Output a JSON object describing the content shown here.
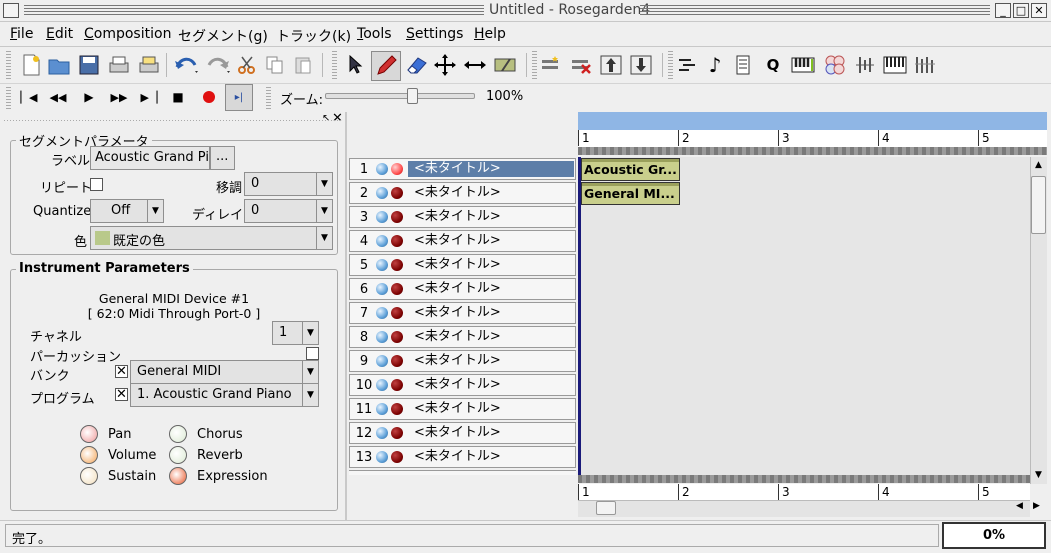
{
  "window": {
    "title": "Untitled - Rosegarden4",
    "minimize": "_",
    "maximize": "□",
    "close": "✕"
  },
  "menu": [
    {
      "label": "File",
      "u": "F",
      "rest": "ile"
    },
    {
      "label": "Edit",
      "u": "E",
      "rest": "dit"
    },
    {
      "label": "Composition",
      "u": "C",
      "rest": "omposition"
    },
    {
      "label": "セグメント(g)",
      "u": "",
      "rest": "セグメント(g)"
    },
    {
      "label": "トラック(k)",
      "u": "",
      "rest": "トラック(k)"
    },
    {
      "label": "Tools",
      "u": "T",
      "rest": "ools"
    },
    {
      "label": "Settings",
      "u": "S",
      "rest": "ettings"
    },
    {
      "label": "Help",
      "u": "H",
      "rest": "elp"
    }
  ],
  "transport": {
    "zoom_label": "ズーム:",
    "zoom_value": "100%",
    "zoom_level_fraction": 0.58
  },
  "segment_params": {
    "title": "セグメントパラメータ",
    "label_label": "ラベル",
    "label_value": "Acoustic Grand Piano",
    "label_button": "...",
    "repeat_label": "リピート",
    "transpose_label": "移調",
    "transpose_value": "0",
    "quantize_label": "Quantize",
    "quantize_value": "Off",
    "delay_label": "ディレイ",
    "delay_value": "0",
    "color_label": "色",
    "color_value": "既定の色",
    "color_swatch": "#b9c98a"
  },
  "instrument_params": {
    "title": "Instrument Parameters",
    "device": "General MIDI Device #1",
    "port": "[ 62:0 Midi Through Port-0 ]",
    "channel_label": "チャネル",
    "channel_value": "1",
    "percussion_label": "パーカッション",
    "bank_label": "バンク",
    "bank_value": "General MIDI",
    "program_label": "プログラム",
    "program_value": "1. Acoustic Grand Piano",
    "knobs": [
      {
        "label": "Pan",
        "color": "#f4b8b8"
      },
      {
        "label": "Chorus",
        "color": "#e6f0e0"
      },
      {
        "label": "Volume",
        "color": "#f7c08a"
      },
      {
        "label": "Reverb",
        "color": "#e6f0e0"
      },
      {
        "label": "Sustain",
        "color": "#f6e8d0"
      },
      {
        "label": "Expression",
        "color": "#f08a6a"
      }
    ]
  },
  "tracks": [
    {
      "num": "1",
      "name": "<未タイトル>",
      "selected": true
    },
    {
      "num": "2",
      "name": "<未タイトル>"
    },
    {
      "num": "3",
      "name": "<未タイトル>"
    },
    {
      "num": "4",
      "name": "<未タイトル>"
    },
    {
      "num": "5",
      "name": "<未タイトル>"
    },
    {
      "num": "6",
      "name": "<未タイトル>"
    },
    {
      "num": "7",
      "name": "<未タイトル>"
    },
    {
      "num": "8",
      "name": "<未タイトル>"
    },
    {
      "num": "9",
      "name": "<未タイトル>"
    },
    {
      "num": "10",
      "name": "<未タイトル>"
    },
    {
      "num": "11",
      "name": "<未タイトル>"
    },
    {
      "num": "12",
      "name": "<未タイトル>"
    },
    {
      "num": "13",
      "name": "<未タイトル>"
    }
  ],
  "ruler": {
    "bars": [
      "1",
      "2",
      "3",
      "4",
      "5"
    ]
  },
  "segments": [
    {
      "label": "Acoustic Gr..."
    },
    {
      "label": "General MI..."
    }
  ],
  "status": {
    "message": "完了。",
    "progress": "0%"
  },
  "colors": {
    "accent": "#5d7ea8",
    "ruler_blue": "#8fb6e5",
    "segment": "#c9cf8c"
  }
}
